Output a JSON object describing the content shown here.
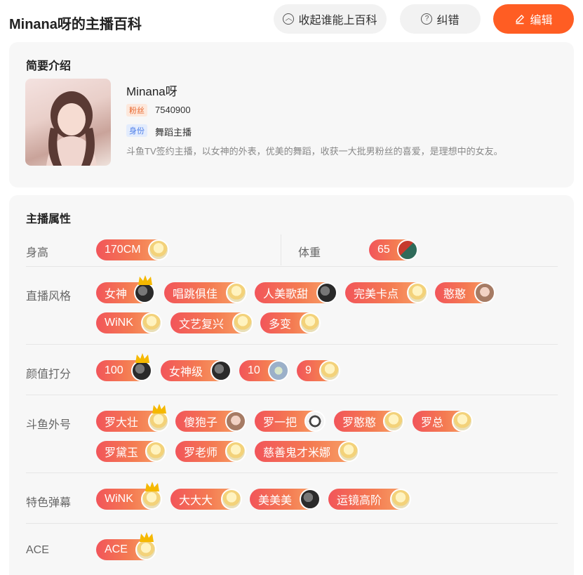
{
  "header": {
    "title": "Minana呀的主播百科",
    "collapse_label": "收起谁能上百科",
    "report_label": "纠错",
    "edit_label": "编辑",
    "edit_color": "#ff5d23"
  },
  "intro": {
    "section_title": "简要介绍",
    "name": "Minana呀",
    "fans_tag": "粉丝",
    "fans_count": "7540900",
    "role_tag": "身份",
    "role": "舞蹈主播",
    "description": "斗鱼TV签约主播，以女神的外表，优美的舞蹈，收获一大批男粉丝的喜爱，是理想中的女友。"
  },
  "attributes": {
    "section_title": "主播属性",
    "height_label": "身高",
    "height_value": "170CM",
    "weight_label": "体重",
    "weight_value": "65",
    "style_label": "直播风格",
    "style_tags": [
      "女神",
      "唱跳俱佳",
      "人美歌甜",
      "完美卡点",
      "憨憨",
      "WiNK",
      "文艺复兴",
      "多变"
    ],
    "looks_label": "颜值打分",
    "looks_tags": [
      "100",
      "女神级",
      "10",
      "9"
    ],
    "nick_label": "斗鱼外号",
    "nick_tags": [
      "罗大壮",
      "傻狍子",
      "罗一把",
      "罗憨憨",
      "罗总",
      "罗黛玉",
      "罗老师",
      "慈善鬼才米娜"
    ],
    "danmu_label": "特色弹幕",
    "danmu_tags": [
      "WiNK",
      "大大大",
      "美美美",
      "运镜高阶"
    ],
    "ace_label": "ACE",
    "ace_tags": [
      "ACE"
    ]
  }
}
